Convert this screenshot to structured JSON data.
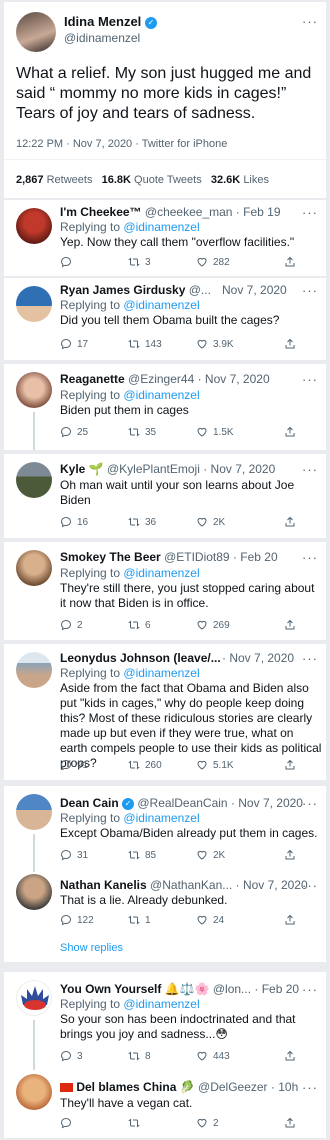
{
  "main_tweet": {
    "name": "Idina Menzel",
    "handle": "@idinamenzel",
    "text": "What a relief.  My son just hugged me and said “ mommy no more kids in cages!” Tears of joy and tears of sadness.",
    "time": "12:22 PM · Nov 7, 2020 · Twitter for iPhone",
    "stats": {
      "retweets_count": "2,867",
      "retweets_label": "Retweets",
      "quotes_count": "16.8K",
      "quotes_label": "Quote Tweets",
      "likes_count": "32.6K",
      "likes_label": "Likes"
    }
  },
  "replies": [
    {
      "name": "I'm Cheekee™",
      "handle": "@cheekee_man · Feb 19",
      "replying_prefix": "Replying to",
      "replying_to": "@idinamenzel",
      "text": "Yep. Now they call them \"overflow facilities.\"",
      "reply_count": "",
      "retweet_count": "3",
      "like_count": "282"
    },
    {
      "name": "Ryan James Girdusky",
      "handle": "@...",
      "date": "Nov 7, 2020",
      "replying_prefix": "Replying to",
      "replying_to": "@idinamenzel",
      "text": "Did you tell them Obama built the cages?",
      "reply_count": "17",
      "retweet_count": "143",
      "like_count": "3.9K"
    },
    {
      "name": "Reaganette",
      "handle": "@Ezinger44 · Nov 7, 2020",
      "replying_prefix": "Replying to",
      "replying_to": "@idinamenzel",
      "text": "Biden put them in cages",
      "reply_count": "25",
      "retweet_count": "35",
      "like_count": "1.5K"
    },
    {
      "name": "Kyle",
      "handle": "@KylePlantEmoji · Nov 7, 2020",
      "text": "Oh man wait until your son learns about Joe Biden",
      "reply_count": "16",
      "retweet_count": "36",
      "like_count": "2K"
    },
    {
      "name": "Smokey The Beer",
      "handle": "@ETIDiot89 · Feb 20",
      "replying_prefix": "Replying to",
      "replying_to": "@idinamenzel",
      "text": "They're still there, you just stopped caring about it now that Biden is in office.",
      "reply_count": "2",
      "retweet_count": "6",
      "like_count": "269"
    },
    {
      "name": "Leonydus Johnson (leave/...",
      "date": "Nov 7, 2020",
      "replying_prefix": "Replying to",
      "replying_to": "@idinamenzel",
      "text": "Aside from the fact that Obama and Biden also put \"kids in cages,\" why do people keep doing this? Most of these ridiculous stories are clearly made up but even if they were true, what on earth compels people to use their kids as political props?",
      "reply_count": "91",
      "retweet_count": "260",
      "like_count": "5.1K"
    },
    {
      "name": "Dean Cain",
      "handle": "@RealDeanCain · Nov 7, 2020",
      "replying_prefix": "Replying to",
      "replying_to": "@idinamenzel",
      "text": "Except Obama/Biden already put them in cages.",
      "reply_count": "31",
      "retweet_count": "85",
      "like_count": "2K"
    },
    {
      "name": "Nathan Kanelis",
      "handle": "@NathanKan... · Nov 7, 2020",
      "text": "That is a lie. Already debunked.",
      "reply_count": "122",
      "retweet_count": "1",
      "like_count": "24"
    },
    {
      "name": "You Own Yourself",
      "handle": "@lon... · Feb 20",
      "replying_prefix": "Replying to",
      "replying_to": "@idinamenzel",
      "text": "So your son has been indoctrinated and that brings you joy and sadness...😳",
      "reply_count": "3",
      "retweet_count": "8",
      "like_count": "443"
    },
    {
      "name": "Del blames China",
      "handle": "@DelGeezer · 10h",
      "text": "They'll have a vegan cat.",
      "reply_count": "",
      "retweet_count": "",
      "like_count": "2"
    }
  ],
  "show_replies": "Show replies",
  "more": "···"
}
